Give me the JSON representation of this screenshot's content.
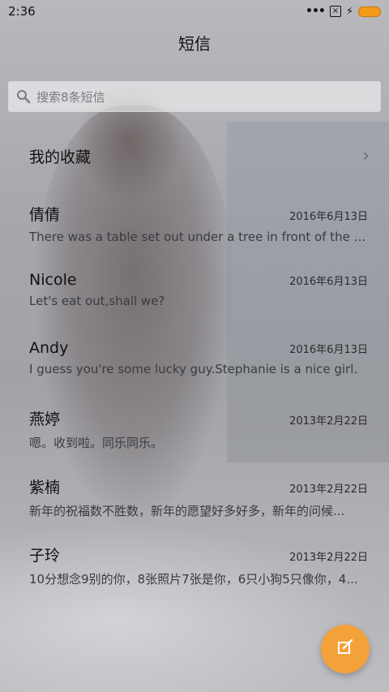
{
  "status_bar": {
    "time": "2:36",
    "dots": "•••",
    "sim_icon": "sim-x-icon",
    "charging_icon": "bolt-icon",
    "battery_color": "#f39a1b"
  },
  "header": {
    "title": "短信"
  },
  "search": {
    "placeholder": "搜索8条短信",
    "icon": "search-icon"
  },
  "favorites": {
    "label": "我的收藏",
    "icon": "chevron-right-icon"
  },
  "conversations": [
    {
      "name": "倩倩",
      "date": "2016年6月13日",
      "preview": "There was a table set out under a tree in front of the ho..."
    },
    {
      "name": "Nicole",
      "date": "2016年6月13日",
      "preview": "Let's eat out,shall we?"
    },
    {
      "name": "Andy",
      "date": "2016年6月13日",
      "preview": "I guess you're some lucky guy.Stephanie is a nice girl."
    },
    {
      "name": "燕婷",
      "date": "2013年2月22日",
      "preview": "嗯。收到啦。同乐同乐。"
    },
    {
      "name": "紫楠",
      "date": "2013年2月22日",
      "preview": "新年的祝福数不胜数，新年的愿望好多好多，新年的问候..."
    },
    {
      "name": "子玲",
      "date": "2013年2月22日",
      "preview": "10分想念9别的你，8张照片7张是你，6只小狗5只像你，4..."
    }
  ],
  "fab": {
    "icon": "compose-icon",
    "color": "#f3a23a"
  }
}
